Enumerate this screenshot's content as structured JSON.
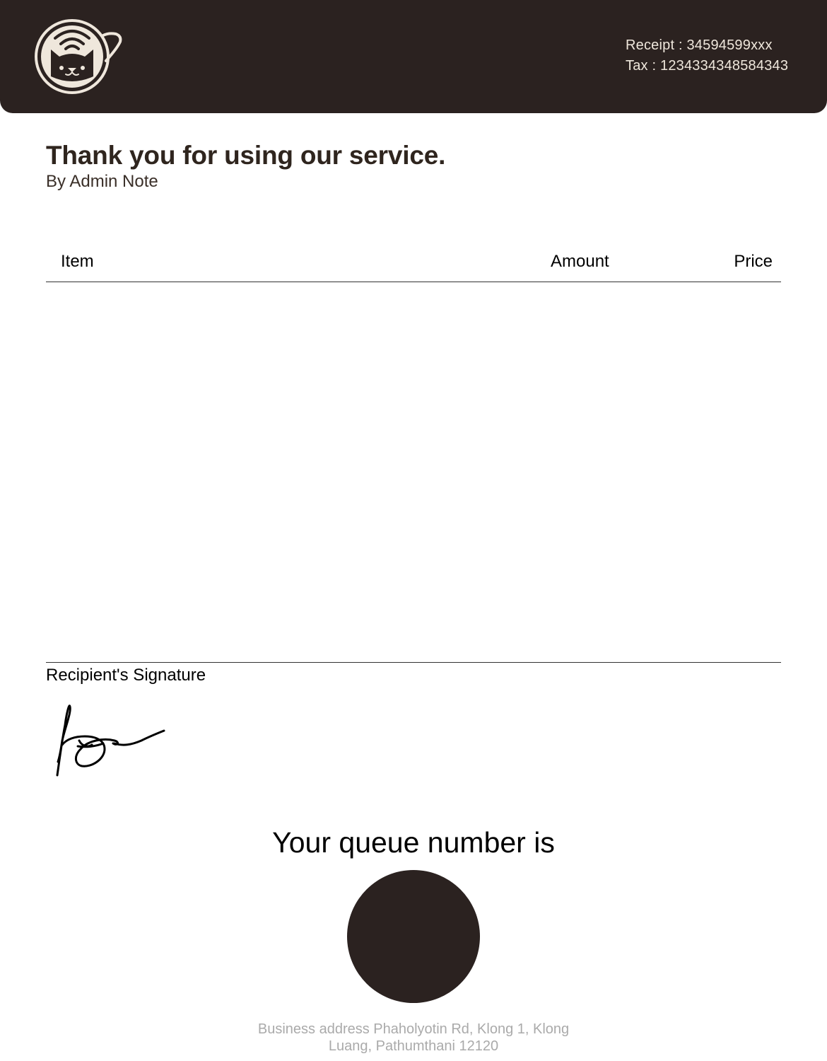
{
  "header": {
    "receipt_label": "Receipt : 34594599xxx",
    "tax_label": "Tax : 1234334348584343",
    "logo_icon": "cat-coffee-cup-wifi-icon",
    "background_color": "#2b2220",
    "logo_color": "#efe7dc"
  },
  "intro": {
    "title": "Thank you for using our service.",
    "note": "By Admin Note"
  },
  "table": {
    "headers": {
      "item": "Item",
      "amount": "Amount",
      "price": "Price"
    },
    "rows": []
  },
  "signature": {
    "label": "Recipient's Signature",
    "icon": "handwritten-signature-icon"
  },
  "queue": {
    "title": "Your queue number is",
    "number": "",
    "circle_color": "#2b2220"
  },
  "footer": {
    "address": "Business address Phaholyotin Rd, Klong 1, Klong Luang, Pathumthani 12120"
  }
}
